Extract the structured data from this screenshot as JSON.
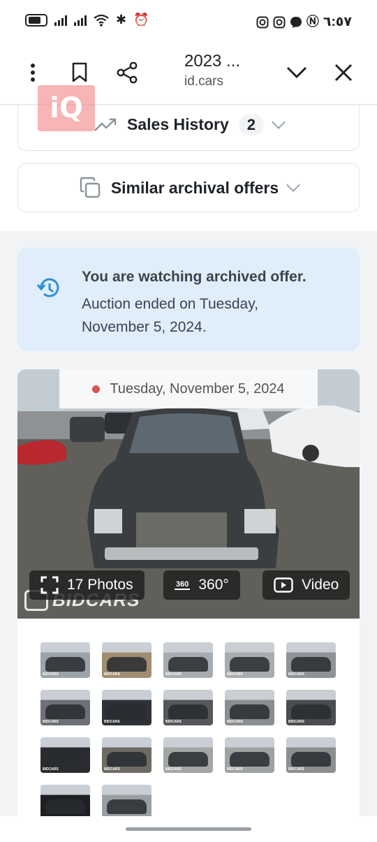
{
  "status_bar": {
    "time": "٦:٥٧",
    "icons": [
      "battery-icon",
      "signal-icon",
      "signal-icon",
      "wifi-icon",
      "bluetooth-icon",
      "alarm-icon",
      "instagram-icon",
      "instagram-icon",
      "threads-icon",
      "nfc-icon"
    ]
  },
  "browser": {
    "title": "2023 ...",
    "url": "id.cars"
  },
  "watermark_logo": "iQ",
  "sections": {
    "sales_history": {
      "label": "Sales History",
      "count": "2"
    },
    "similar_offers": {
      "label": "Similar archival offers"
    }
  },
  "archive_notice": {
    "title": "You are watching archived offer.",
    "message": "Auction ended on Tuesday, November 5, 2024."
  },
  "photo": {
    "date": "Tuesday, November 5, 2024",
    "photos_label": "17 Photos",
    "badge_360": "360",
    "view_360_label": "360°",
    "video_label": "Video",
    "watermark": "BIDCARS"
  },
  "thumbnails": [
    {
      "label": "BIDCARS",
      "bg": "#9aa3a8"
    },
    {
      "label": "BIDCARS",
      "bg": "#a08d72"
    },
    {
      "label": "BIDCARS",
      "bg": "#a7acb0"
    },
    {
      "label": "BIDCARS",
      "bg": "#a9acae"
    },
    {
      "label": "BIDCARS",
      "bg": "#8f9296"
    },
    {
      "label": "BIDCARS",
      "bg": "#6d7075"
    },
    {
      "label": "BIDCARS",
      "bg": "#2e3236"
    },
    {
      "label": "BIDCARS",
      "bg": "#55575a"
    },
    {
      "label": "BIDCARS",
      "bg": "#8b8e90"
    },
    {
      "label": "BIDCARS",
      "bg": "#4a4c4f"
    },
    {
      "label": "BIDCARS",
      "bg": "#2a2c2f"
    },
    {
      "label": "BIDCARS",
      "bg": "#6e6a64"
    },
    {
      "label": "BIDCARS",
      "bg": "#a4a6a3"
    },
    {
      "label": "BIDCARS",
      "bg": "#9ea3a2"
    },
    {
      "label": "BIDCARS",
      "bg": "#8c8f8e"
    },
    {
      "label": "",
      "bg": "#1d1f22"
    },
    {
      "label": "",
      "bg": "#9a9fa2"
    }
  ]
}
